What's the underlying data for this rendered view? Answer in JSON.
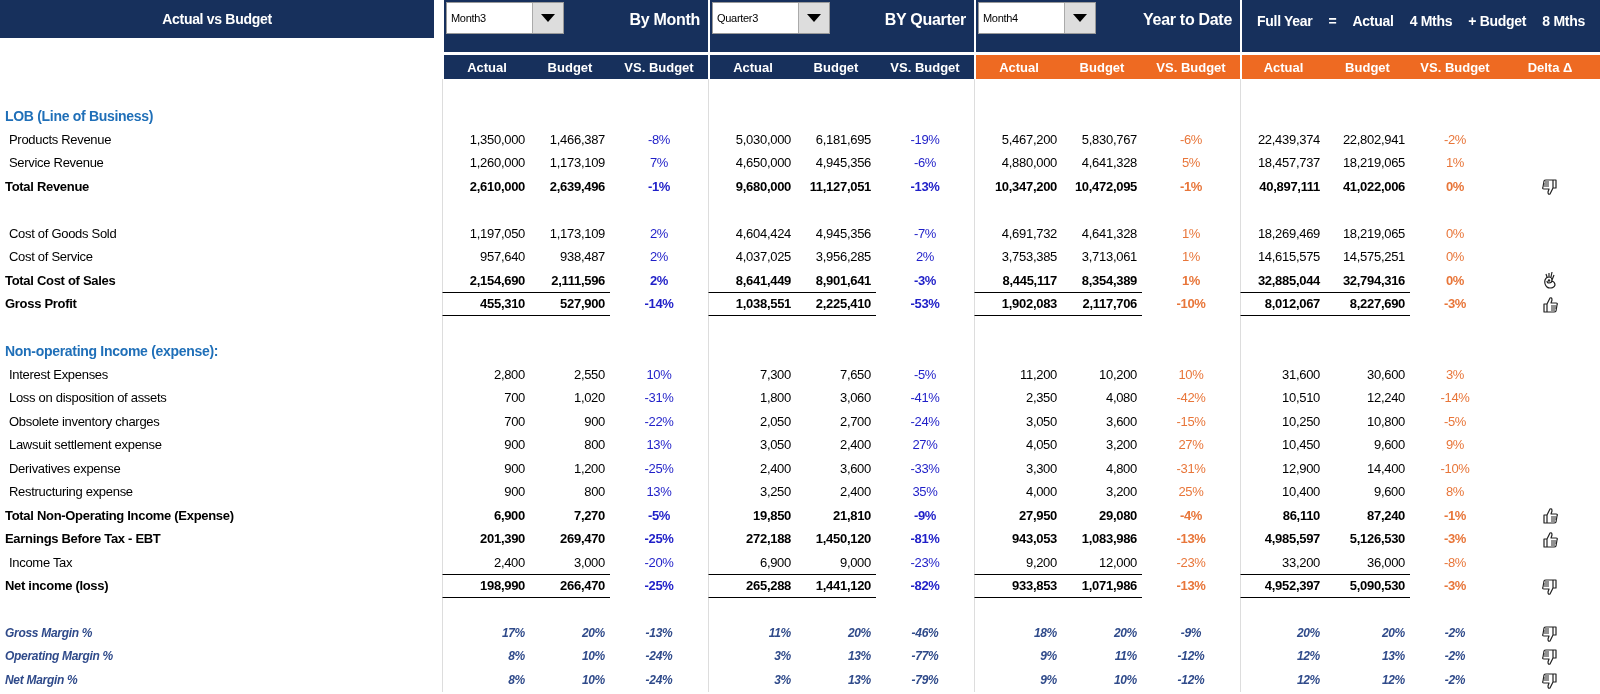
{
  "title": "Actual vs Budget",
  "groups": [
    {
      "kind": "current",
      "dropdown": "Month3",
      "title": "By Month",
      "columns": [
        "Actual",
        "Budget",
        "VS. Budget"
      ]
    },
    {
      "kind": "current",
      "dropdown": "Quarter3",
      "title": "BY Quarter",
      "columns": [
        "Actual",
        "Budget",
        "VS. Budget"
      ]
    },
    {
      "kind": "cumulative",
      "dropdown": "Month4",
      "title": "Year to Date",
      "columns": [
        "Actual",
        "Budget",
        "VS. Budget"
      ]
    },
    {
      "kind": "cumulative",
      "formula": [
        "Full Year",
        "=",
        "Actual",
        "4 Mths",
        "+ Budget",
        "8 Mths"
      ],
      "columns": [
        "Actual",
        "Budget",
        "VS. Budget",
        "Delta Δ"
      ]
    }
  ],
  "sections": [
    {
      "rows": [
        {
          "kind": "section",
          "label": "LOB (Line of Business)"
        },
        {
          "kind": "item",
          "label": "Products Revenue",
          "values": [
            [
              "1,350,000",
              "1,466,387",
              "-8%"
            ],
            [
              "5,030,000",
              "6,181,695",
              "-19%"
            ],
            [
              "5,467,200",
              "5,830,767",
              "-6%"
            ],
            [
              "22,439,374",
              "22,802,941",
              "-2%"
            ]
          ]
        },
        {
          "kind": "item",
          "label": "Service Revenue",
          "values": [
            [
              "1,260,000",
              "1,173,109",
              "7%"
            ],
            [
              "4,650,000",
              "4,945,356",
              "-6%"
            ],
            [
              "4,880,000",
              "4,641,328",
              "5%"
            ],
            [
              "18,457,737",
              "18,219,065",
              "1%"
            ]
          ]
        },
        {
          "kind": "total",
          "label": "Total Revenue",
          "delta": {
            "kind": "thumbs_down"
          },
          "values": [
            [
              "2,610,000",
              "2,639,496",
              "-1%"
            ],
            [
              "9,680,000",
              "11,127,051",
              "-13%"
            ],
            [
              "10,347,200",
              "10,472,095",
              "-1%"
            ],
            [
              "40,897,111",
              "41,022,006",
              "0%"
            ]
          ]
        }
      ]
    },
    {
      "rows": [
        {
          "kind": "item",
          "label": "Cost of Goods Sold",
          "values": [
            [
              "1,197,050",
              "1,173,109",
              "2%"
            ],
            [
              "4,604,424",
              "4,945,356",
              "-7%"
            ],
            [
              "4,691,732",
              "4,641,328",
              "1%"
            ],
            [
              "18,269,469",
              "18,219,065",
              "0%"
            ]
          ]
        },
        {
          "kind": "item",
          "label": "Cost of Service",
          "values": [
            [
              "957,640",
              "938,487",
              "2%"
            ],
            [
              "4,037,025",
              "3,956,285",
              "2%"
            ],
            [
              "3,753,385",
              "3,713,061",
              "1%"
            ],
            [
              "14,615,575",
              "14,575,251",
              "0%"
            ]
          ]
        },
        {
          "kind": "total",
          "label": "Total Cost of Sales",
          "delta": {
            "kind": "ok_hand"
          },
          "values": [
            [
              "2,154,690",
              "2,111,596",
              "2%"
            ],
            [
              "8,641,449",
              "8,901,641",
              "-3%"
            ],
            [
              "8,445,117",
              "8,354,389",
              "1%"
            ],
            [
              "32,885,044",
              "32,794,316",
              "0%"
            ]
          ]
        },
        {
          "kind": "result",
          "label": "Gross Profit",
          "delta": {
            "kind": "thumbs_up"
          },
          "values": [
            [
              "455,310",
              "527,900",
              "-14%"
            ],
            [
              "1,038,551",
              "2,225,410",
              "-53%"
            ],
            [
              "1,902,083",
              "2,117,706",
              "-10%"
            ],
            [
              "8,012,067",
              "8,227,690",
              "-3%"
            ]
          ]
        }
      ]
    },
    {
      "rows": [
        {
          "kind": "section",
          "label": "Non-operating Income (expense):"
        },
        {
          "kind": "item",
          "label": "Interest Expenses",
          "values": [
            [
              "2,800",
              "2,550",
              "10%"
            ],
            [
              "7,300",
              "7,650",
              "-5%"
            ],
            [
              "11,200",
              "10,200",
              "10%"
            ],
            [
              "31,600",
              "30,600",
              "3%"
            ]
          ]
        },
        {
          "kind": "item",
          "label": "Loss on disposition of assets",
          "values": [
            [
              "700",
              "1,020",
              "-31%"
            ],
            [
              "1,800",
              "3,060",
              "-41%"
            ],
            [
              "2,350",
              "4,080",
              "-42%"
            ],
            [
              "10,510",
              "12,240",
              "-14%"
            ]
          ]
        },
        {
          "kind": "item",
          "label": "Obsolete inventory charges",
          "values": [
            [
              "700",
              "900",
              "-22%"
            ],
            [
              "2,050",
              "2,700",
              "-24%"
            ],
            [
              "3,050",
              "3,600",
              "-15%"
            ],
            [
              "10,250",
              "10,800",
              "-5%"
            ]
          ]
        },
        {
          "kind": "item",
          "label": "Lawsuit settlement expense",
          "values": [
            [
              "900",
              "800",
              "13%"
            ],
            [
              "3,050",
              "2,400",
              "27%"
            ],
            [
              "4,050",
              "3,200",
              "27%"
            ],
            [
              "10,450",
              "9,600",
              "9%"
            ]
          ]
        },
        {
          "kind": "item",
          "label": "Derivatives expense",
          "values": [
            [
              "900",
              "1,200",
              "-25%"
            ],
            [
              "2,400",
              "3,600",
              "-33%"
            ],
            [
              "3,300",
              "4,800",
              "-31%"
            ],
            [
              "12,900",
              "14,400",
              "-10%"
            ]
          ]
        },
        {
          "kind": "item",
          "label": "Restructuring expense",
          "values": [
            [
              "900",
              "800",
              "13%"
            ],
            [
              "3,250",
              "2,400",
              "35%"
            ],
            [
              "4,000",
              "3,200",
              "25%"
            ],
            [
              "10,400",
              "9,600",
              "8%"
            ]
          ]
        },
        {
          "kind": "total",
          "label": "Total Non-Operating Income (Expense)",
          "delta": {
            "kind": "thumbs_up"
          },
          "values": [
            [
              "6,900",
              "7,270",
              "-5%"
            ],
            [
              "19,850",
              "21,810",
              "-9%"
            ],
            [
              "27,950",
              "29,080",
              "-4%"
            ],
            [
              "86,110",
              "87,240",
              "-1%"
            ]
          ]
        },
        {
          "kind": "total",
          "label": "Earnings Before Tax - EBT",
          "delta": {
            "kind": "thumbs_up"
          },
          "values": [
            [
              "201,390",
              "269,470",
              "-25%"
            ],
            [
              "272,188",
              "1,450,120",
              "-81%"
            ],
            [
              "943,053",
              "1,083,986",
              "-13%"
            ],
            [
              "4,985,597",
              "5,126,530",
              "-3%"
            ]
          ]
        },
        {
          "kind": "item",
          "label": "Income Tax",
          "values": [
            [
              "2,400",
              "3,000",
              "-20%"
            ],
            [
              "6,900",
              "9,000",
              "-23%"
            ],
            [
              "9,200",
              "12,000",
              "-23%"
            ],
            [
              "33,200",
              "36,000",
              "-8%"
            ]
          ]
        },
        {
          "kind": "result",
          "label": "Net income (loss)",
          "delta": {
            "kind": "thumbs_down"
          },
          "values": [
            [
              "198,990",
              "266,470",
              "-25%"
            ],
            [
              "265,288",
              "1,441,120",
              "-82%"
            ],
            [
              "933,853",
              "1,071,986",
              "-13%"
            ],
            [
              "4,952,397",
              "5,090,530",
              "-3%"
            ]
          ]
        }
      ]
    },
    {
      "rows": [
        {
          "kind": "margin",
          "label": "Gross Margin %",
          "delta": {
            "kind": "thumbs_down"
          },
          "values": [
            [
              "17%",
              "20%",
              "-13%"
            ],
            [
              "11%",
              "20%",
              "-46%"
            ],
            [
              "18%",
              "20%",
              "-9%"
            ],
            [
              "20%",
              "20%",
              "-2%"
            ]
          ]
        },
        {
          "kind": "margin",
          "label": "Operating Margin %",
          "delta": {
            "kind": "thumbs_down"
          },
          "values": [
            [
              "8%",
              "10%",
              "-24%"
            ],
            [
              "3%",
              "13%",
              "-77%"
            ],
            [
              "9%",
              "11%",
              "-12%"
            ],
            [
              "12%",
              "13%",
              "-2%"
            ]
          ]
        },
        {
          "kind": "margin",
          "label": "Net Margin %",
          "delta": {
            "kind": "thumbs_down"
          },
          "values": [
            [
              "8%",
              "10%",
              "-24%"
            ],
            [
              "3%",
              "13%",
              "-79%"
            ],
            [
              "9%",
              "10%",
              "-12%"
            ],
            [
              "12%",
              "12%",
              "-2%"
            ]
          ]
        }
      ]
    }
  ]
}
